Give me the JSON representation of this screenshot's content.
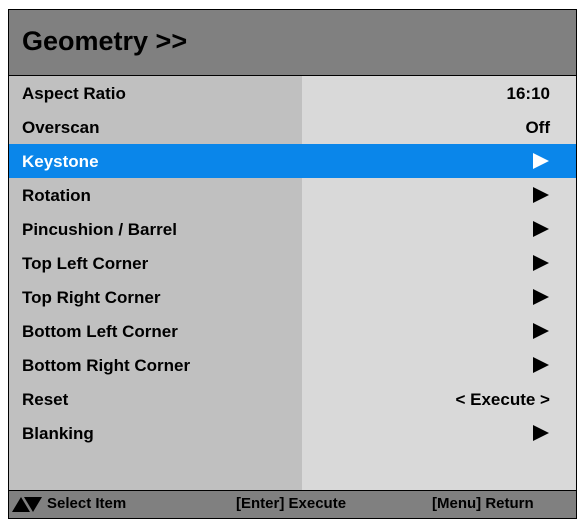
{
  "menu": {
    "title": "Geometry >>",
    "items": [
      {
        "label": "Aspect Ratio",
        "value": "16:10",
        "has_submenu": false,
        "selected": false
      },
      {
        "label": "Overscan",
        "value": "Off",
        "has_submenu": false,
        "selected": false
      },
      {
        "label": "Keystone",
        "value": "",
        "has_submenu": true,
        "selected": true
      },
      {
        "label": "Rotation",
        "value": "",
        "has_submenu": true,
        "selected": false
      },
      {
        "label": "Pincushion / Barrel",
        "value": "",
        "has_submenu": true,
        "selected": false
      },
      {
        "label": "Top Left Corner",
        "value": "",
        "has_submenu": true,
        "selected": false
      },
      {
        "label": "Top Right Corner",
        "value": "",
        "has_submenu": true,
        "selected": false
      },
      {
        "label": "Bottom Left Corner",
        "value": "",
        "has_submenu": true,
        "selected": false
      },
      {
        "label": "Bottom Right Corner",
        "value": "",
        "has_submenu": true,
        "selected": false
      },
      {
        "label": "Reset",
        "value": "< Execute >",
        "has_submenu": false,
        "selected": false
      },
      {
        "label": "Blanking",
        "value": "",
        "has_submenu": true,
        "selected": false
      }
    ]
  },
  "footer": {
    "select_hint": "Select Item",
    "execute_hint": "[Enter] Execute",
    "return_hint": "[Menu] Return"
  },
  "colors": {
    "selected_row": "#0a86ea",
    "header_bg": "#808080",
    "label_column_bg": "#c0c0c0",
    "value_column_bg": "#d9d9d9"
  },
  "icons": {
    "submenu": "triangle-right-icon",
    "navigation": "up-down-arrows-icon"
  }
}
